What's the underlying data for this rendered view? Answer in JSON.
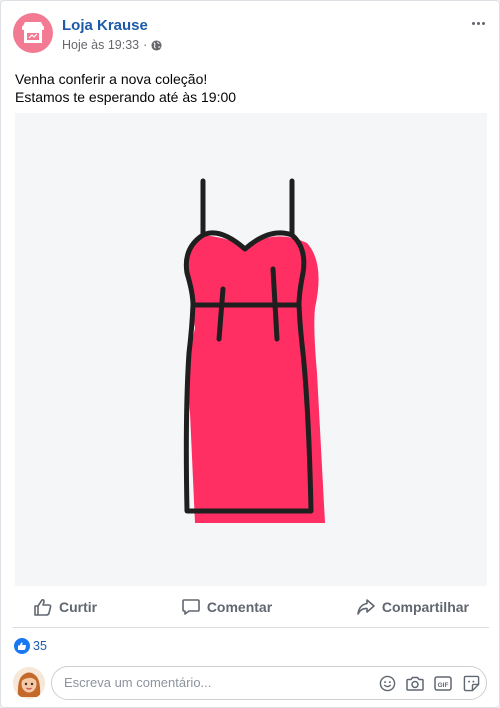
{
  "post": {
    "page_name": "Loja Krause",
    "timestamp": "Hoje às 19:33",
    "separator": "·",
    "privacy_icon": "globe-icon",
    "text_lines": [
      "Venha conferir a nova coleção!",
      "Estamos te esperando até às 19:00"
    ]
  },
  "media": {
    "subject": "dress-illustration",
    "colors": {
      "background": "#f5f6f8",
      "dress": "#ff2e63",
      "outline": "#1f1f1f"
    }
  },
  "actions": [
    {
      "label": "Curtir",
      "icon": "thumbs-up-icon"
    },
    {
      "label": "Comentar",
      "icon": "comment-icon"
    },
    {
      "label": "Compartilhar",
      "icon": "share-icon"
    }
  ],
  "reactions": {
    "count": "35",
    "icon": "like-reaction-icon"
  },
  "comment": {
    "placeholder": "Escreva um comentário...",
    "icons": [
      "emoji-icon",
      "camera-icon",
      "gif-icon",
      "sticker-icon"
    ]
  },
  "colors": {
    "brand": "#1d5aa8",
    "accent": "#f27a93",
    "like": "#1877f2"
  }
}
